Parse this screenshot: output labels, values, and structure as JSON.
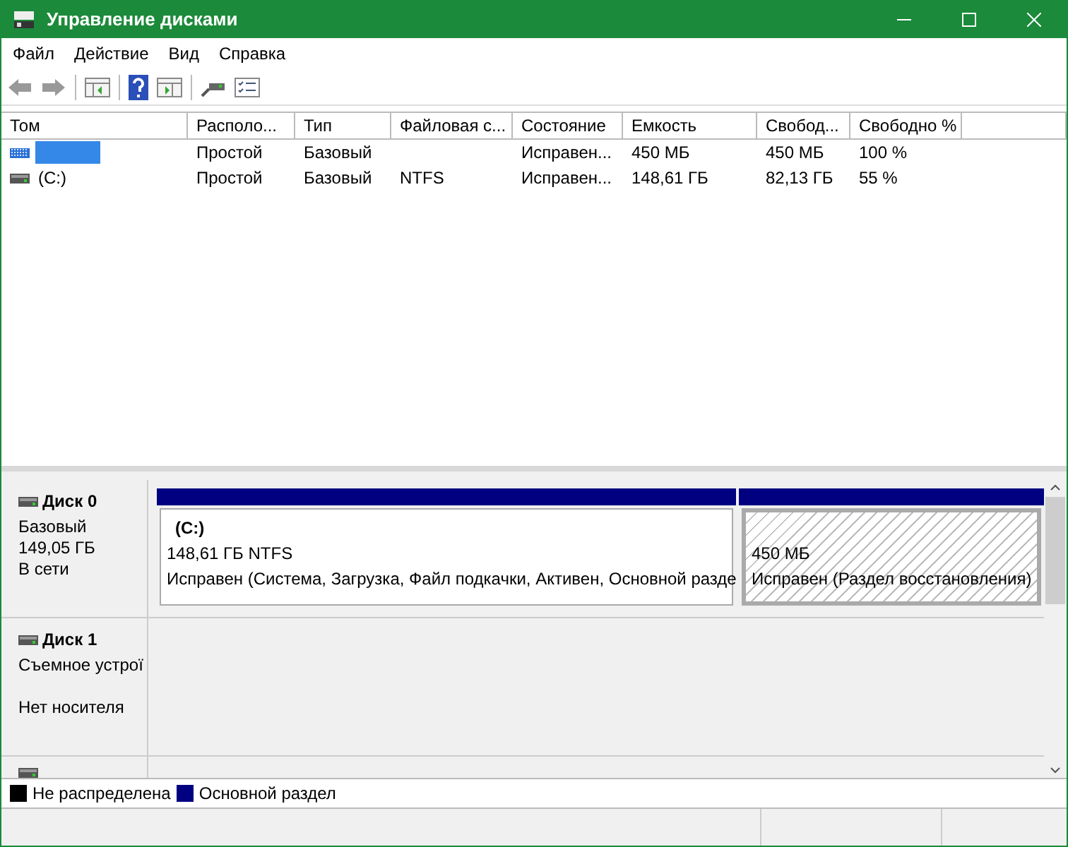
{
  "window": {
    "title": "Управление дисками"
  },
  "menu": [
    "Файл",
    "Действие",
    "Вид",
    "Справка"
  ],
  "table": {
    "columns": [
      "Том",
      "Располо...",
      "Тип",
      "Файловая с...",
      "Состояние",
      "Емкость",
      "Свобод...",
      "Свободно %"
    ],
    "rows": [
      {
        "kind": "striped",
        "selected": true,
        "cells": [
          "",
          "Простой",
          "Базовый",
          "",
          "Исправен...",
          "450 МБ",
          "450 МБ",
          "100 %"
        ]
      },
      {
        "kind": "drive",
        "selected": false,
        "cells": [
          "(C:)",
          "Простой",
          "Базовый",
          "NTFS",
          "Исправен...",
          "148,61 ГБ",
          "82,13 ГБ",
          "55 %"
        ]
      }
    ]
  },
  "disks": [
    {
      "name": "Диск 0",
      "type": "Базовый",
      "size": "149,05 ГБ",
      "status": "В сети",
      "partitions": [
        {
          "selected": false,
          "name": "(C:)",
          "size": "148,61 ГБ NTFS",
          "status": "Исправен (Система, Загрузка, Файл подкачки, Активен, Основной разде"
        },
        {
          "selected": true,
          "size": "450 МБ",
          "status": "Исправен (Раздел восстановления)"
        }
      ]
    },
    {
      "name": "Диск 1",
      "type": "Съемное устрої",
      "status": "Нет носителя"
    }
  ],
  "legend": [
    {
      "label": "Не распределена",
      "color": "#000000"
    },
    {
      "label": "Основной раздел",
      "color": "#000080"
    }
  ]
}
